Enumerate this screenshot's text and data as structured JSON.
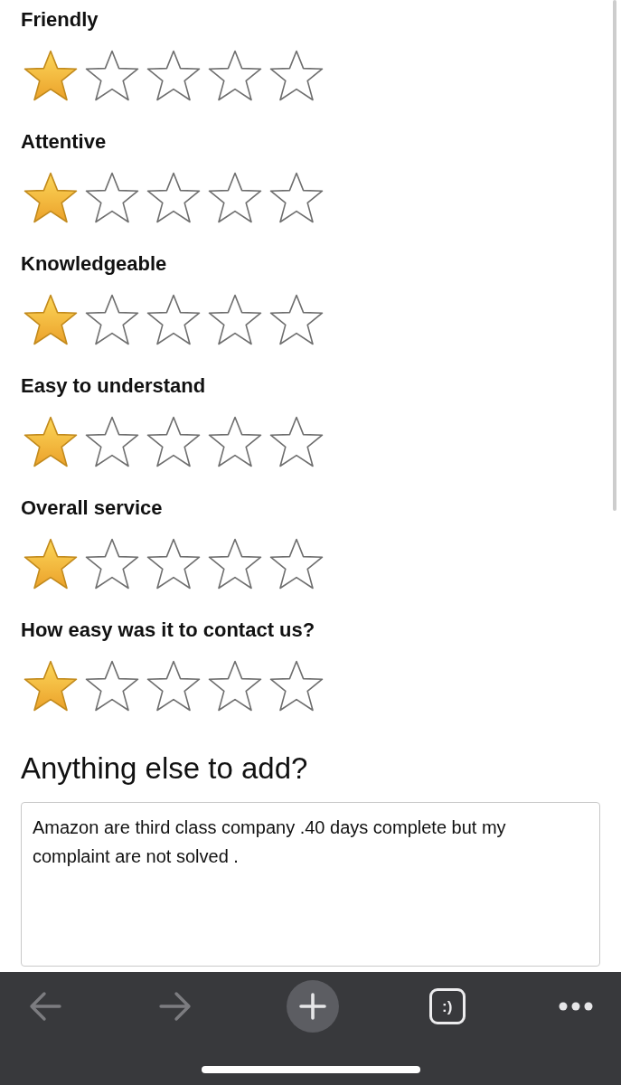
{
  "ratings": [
    {
      "label": "Friendly",
      "stars": 1
    },
    {
      "label": "Attentive",
      "stars": 1
    },
    {
      "label": "Knowledgeable",
      "stars": 1
    },
    {
      "label": "Easy to understand",
      "stars": 1
    },
    {
      "label": "Overall service",
      "stars": 1
    },
    {
      "label": "How easy was it to contact us?",
      "stars": 1
    }
  ],
  "comment": {
    "heading": "Anything else to add?",
    "value": "Amazon are third class company .40 days complete but my complaint are not solved ."
  },
  "toolbar": {
    "buttons": [
      {
        "kind": "back",
        "disabled": true
      },
      {
        "kind": "forward",
        "disabled": true
      },
      {
        "kind": "new_tab",
        "disabled": false
      },
      {
        "kind": "tabs",
        "label": ":)",
        "disabled": false
      },
      {
        "kind": "menu",
        "disabled": false
      }
    ]
  }
}
